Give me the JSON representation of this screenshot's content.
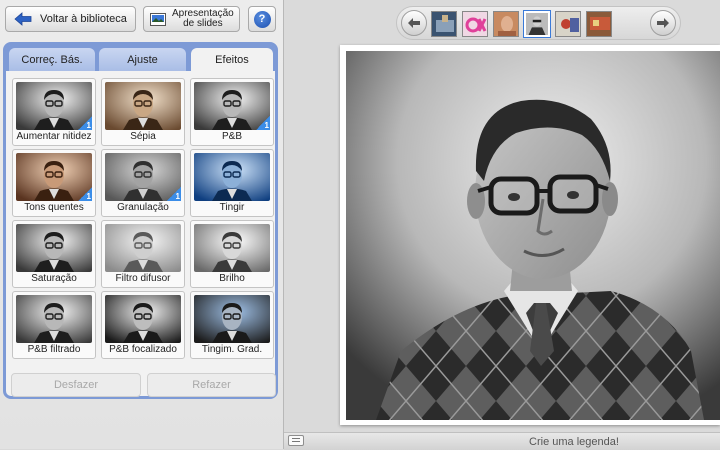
{
  "toolbar": {
    "back_label": "Voltar à biblioteca",
    "slideshow_label_line1": "Apresentação",
    "slideshow_label_line2": "de slides",
    "help_label": "?"
  },
  "tabs": [
    {
      "label": "Correç. Bás.",
      "active": false
    },
    {
      "label": "Ajuste",
      "active": false
    },
    {
      "label": "Efeitos",
      "active": true
    }
  ],
  "effects": [
    {
      "label": "Aumentar nitidez",
      "tone": "bw",
      "badge": "1"
    },
    {
      "label": "Sépia",
      "tone": "sepia",
      "badge": ""
    },
    {
      "label": "P&B",
      "tone": "bw",
      "badge": "1"
    },
    {
      "label": "Tons quentes",
      "tone": "warm",
      "badge": "1"
    },
    {
      "label": "Granulação",
      "tone": "grain",
      "badge": "1"
    },
    {
      "label": "Tingir",
      "tone": "blue",
      "badge": ""
    },
    {
      "label": "Saturação",
      "tone": "bw",
      "badge": ""
    },
    {
      "label": "Filtro difusor",
      "tone": "soft",
      "badge": ""
    },
    {
      "label": "Brilho",
      "tone": "bright",
      "badge": ""
    },
    {
      "label": "P&B filtrado",
      "tone": "bw",
      "badge": ""
    },
    {
      "label": "P&B focalizado",
      "tone": "focus",
      "badge": ""
    },
    {
      "label": "Tingim. Grad.",
      "tone": "grad",
      "badge": ""
    }
  ],
  "actions": {
    "undo_label": "Desfazer",
    "redo_label": "Refazer"
  },
  "caption": {
    "placeholder": "Crie uma legenda!"
  },
  "colors": {
    "panel_border": "#7d9ad6",
    "badge": "#3b8de8",
    "help": "#1c4fb0"
  }
}
